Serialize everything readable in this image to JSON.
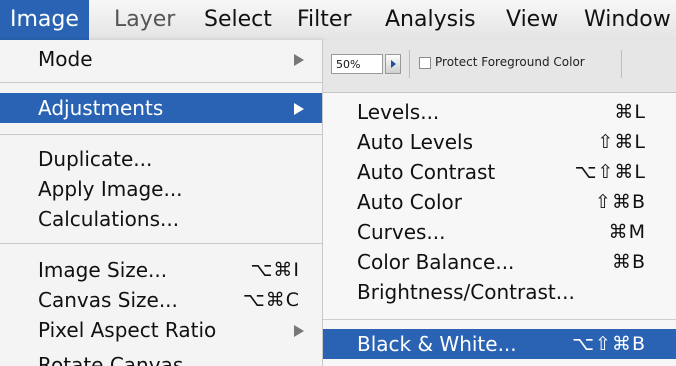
{
  "menubar": {
    "items": [
      {
        "label": "Image"
      },
      {
        "label": "Layer"
      },
      {
        "label": "Select"
      },
      {
        "label": "Filter"
      },
      {
        "label": "Analysis"
      },
      {
        "label": "View"
      },
      {
        "label": "Window"
      }
    ]
  },
  "image_menu": {
    "items": [
      {
        "label": "Mode"
      },
      {
        "label": "Adjustments"
      },
      {
        "label": "Duplicate..."
      },
      {
        "label": "Apply Image..."
      },
      {
        "label": "Calculations..."
      },
      {
        "label": "Image Size...",
        "shortcut": "⌥⌘I"
      },
      {
        "label": "Canvas Size...",
        "shortcut": "⌥⌘C"
      },
      {
        "label": "Pixel Aspect Ratio"
      },
      {
        "label": "Rotate Canvas"
      }
    ]
  },
  "options_bar": {
    "zoom_value": "50%",
    "protect_label": "Protect Foreground Color",
    "protect_checked": false
  },
  "adjustments_menu": {
    "items": [
      {
        "label": "Levels...",
        "shortcut": "⌘L"
      },
      {
        "label": "Auto Levels",
        "shortcut": "⇧⌘L"
      },
      {
        "label": "Auto Contrast",
        "shortcut": "⌥⇧⌘L"
      },
      {
        "label": "Auto Color",
        "shortcut": "⇧⌘B"
      },
      {
        "label": "Curves...",
        "shortcut": "⌘M"
      },
      {
        "label": "Color Balance...",
        "shortcut": "⌘B"
      },
      {
        "label": "Brightness/Contrast..."
      },
      {
        "label": "Black & White...",
        "shortcut": "⌥⇧⌘B"
      }
    ]
  },
  "colors": {
    "highlight": "#2a63b3",
    "menu_bg": "#f4f4f4"
  }
}
